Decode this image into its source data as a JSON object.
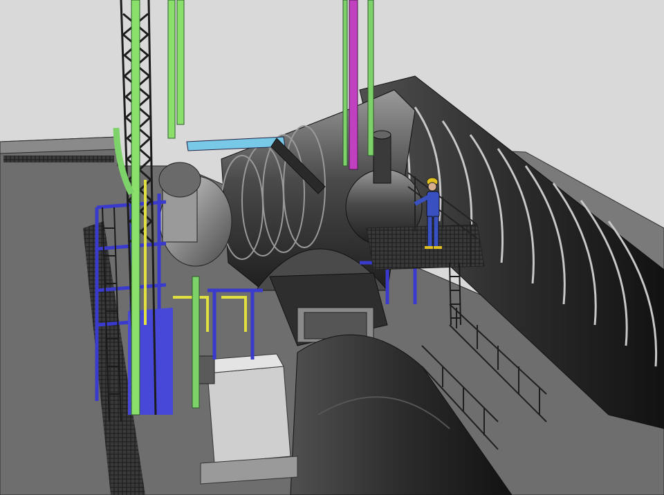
{
  "scene": {
    "colors": {
      "background": "#d9d9d9",
      "ground": "#7a7a7a",
      "ground_dark": "#555555",
      "vessel": "#3a3a3a",
      "vessel_light": "#8c8c8c",
      "steel_blue": "#4a4ad8",
      "pipe_green": "#7dd36a",
      "pipe_magenta": "#c040c0",
      "pipe_yellow": "#e0e040",
      "lattice_green": "#8ae06a",
      "worker": "#3850c0",
      "helmet": "#e0c020"
    }
  }
}
